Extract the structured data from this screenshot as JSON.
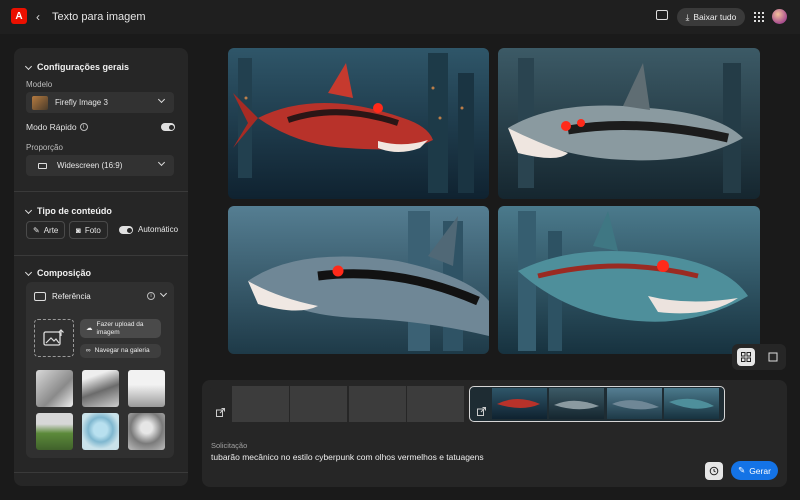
{
  "header": {
    "title": "Texto para imagem",
    "download_all": "Baixar tudo"
  },
  "sidebar": {
    "general": {
      "title": "Configurações gerais",
      "model_label": "Modelo",
      "model_value": "Firefly Image 3",
      "fast_mode_label": "Modo Rápido",
      "fast_mode_on": true,
      "ratio_label": "Proporção",
      "ratio_value": "Widescreen (16:9)"
    },
    "content_type": {
      "title": "Tipo de conteúdo",
      "art": "Arte",
      "photo": "Foto",
      "auto": "Automático",
      "auto_on": true
    },
    "composition": {
      "title": "Composição",
      "reference": "Referência",
      "upload": "Fazer upload da imagem",
      "browse": "Navegar na galeria"
    }
  },
  "images": [
    {
      "scene": "red-shark-left"
    },
    {
      "scene": "silver-shark-left"
    },
    {
      "scene": "blue-shark-left"
    },
    {
      "scene": "teal-shark-right"
    }
  ],
  "prompt": {
    "label": "Solicitação",
    "text": "tubarão mecânico no estilo cyberpunk com olhos vermelhos e tatuagens",
    "generate": "Gerar"
  },
  "colors": {
    "accent": "#1473e6",
    "brand": "#eb1000"
  }
}
